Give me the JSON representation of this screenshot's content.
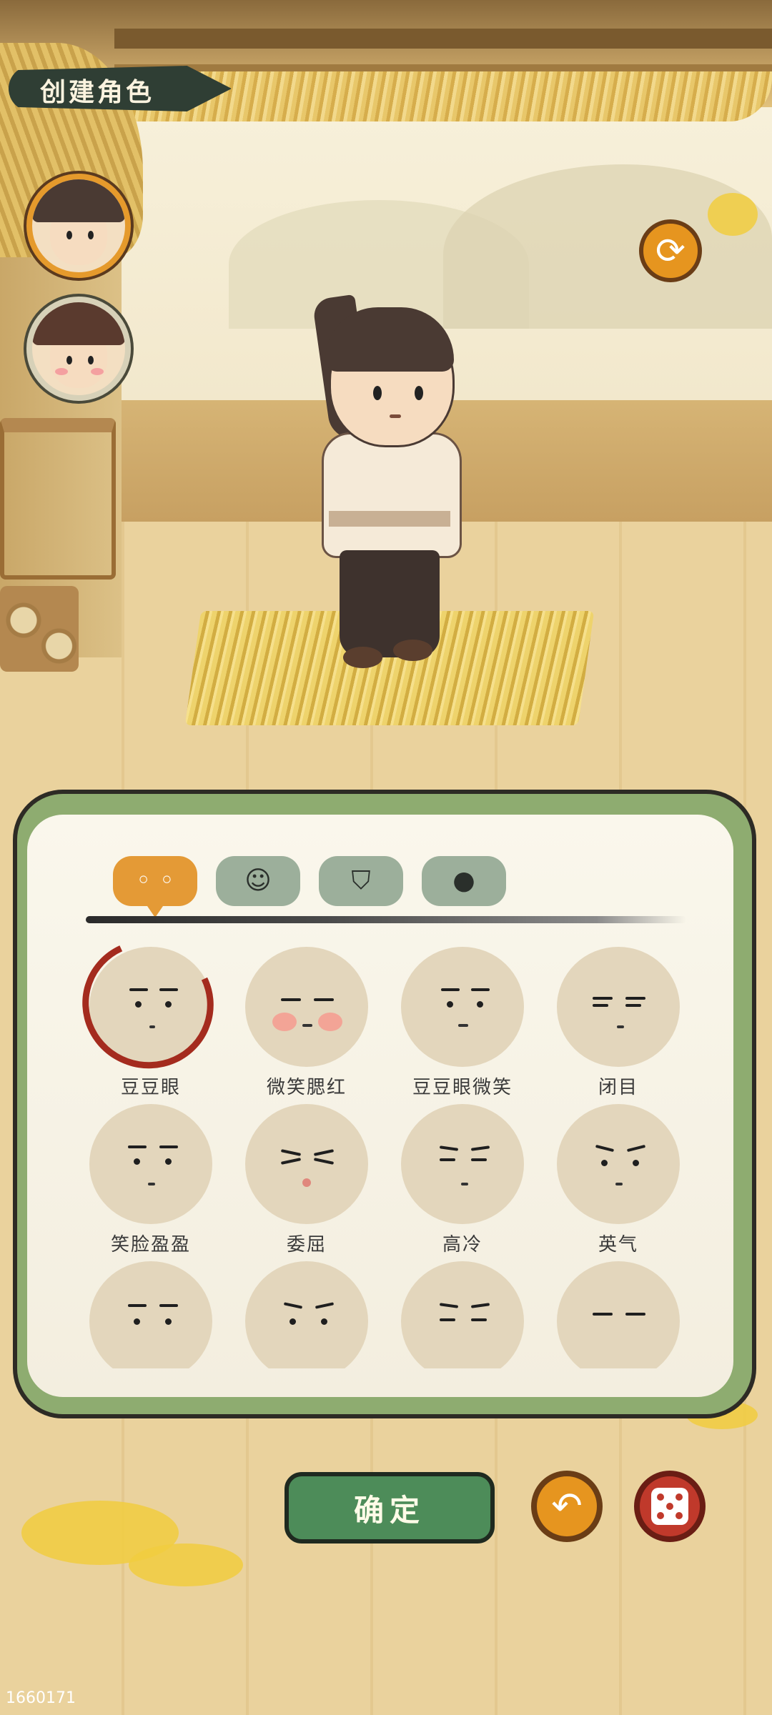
{
  "header": {
    "title": "创建角色"
  },
  "avatars": [
    {
      "name": "male-avatar",
      "selected": true
    },
    {
      "name": "female-avatar",
      "selected": false
    }
  ],
  "refresh_icon": "refresh-icon",
  "tabs": [
    {
      "icon": "eyes-icon",
      "active": true
    },
    {
      "icon": "hairstyle-icon",
      "active": false
    },
    {
      "icon": "clothing-icon",
      "active": false
    },
    {
      "icon": "head-icon",
      "active": false
    }
  ],
  "faces": [
    {
      "label": "豆豆眼",
      "selected": true
    },
    {
      "label": "微笑腮红",
      "selected": false
    },
    {
      "label": "豆豆眼微笑",
      "selected": false
    },
    {
      "label": "闭目",
      "selected": false
    },
    {
      "label": "笑脸盈盈",
      "selected": false
    },
    {
      "label": "委屈",
      "selected": false
    },
    {
      "label": "高冷",
      "selected": false
    },
    {
      "label": "英气",
      "selected": false
    }
  ],
  "buttons": {
    "confirm": "确定",
    "undo_icon": "undo-icon",
    "random_icon": "dice-icon"
  },
  "footer": {
    "version": "1660171"
  },
  "colors": {
    "accent_orange": "#e49a36",
    "panel_green": "#8eac70",
    "confirm_green": "#4d8c59",
    "selected_ring": "#a42b1e",
    "dice_red": "#c0392b"
  }
}
